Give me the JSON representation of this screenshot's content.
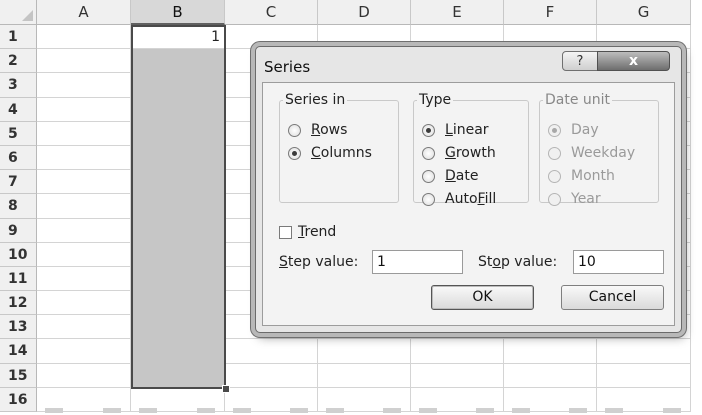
{
  "sheet": {
    "columns": [
      {
        "label": "A",
        "width": 94
      },
      {
        "label": "B",
        "width": 94
      },
      {
        "label": "C",
        "width": 93
      },
      {
        "label": "D",
        "width": 93
      },
      {
        "label": "E",
        "width": 93
      },
      {
        "label": "F",
        "width": 93
      },
      {
        "label": "G",
        "width": 94
      }
    ],
    "rows": [
      "1",
      "2",
      "3",
      "4",
      "5",
      "6",
      "7",
      "8",
      "9",
      "10",
      "11",
      "12",
      "13",
      "14",
      "15",
      "16"
    ],
    "cell_B1": "1"
  },
  "dialog": {
    "title": "Series",
    "help_label": "?",
    "close_label": "x",
    "series_in": {
      "legend": "Series in",
      "options": [
        {
          "pre": "",
          "ul": "R",
          "post": "ows",
          "checked": false
        },
        {
          "pre": "",
          "ul": "C",
          "post": "olumns",
          "checked": true
        }
      ]
    },
    "type": {
      "legend": "Type",
      "options": [
        {
          "pre": "",
          "ul": "L",
          "post": "inear",
          "checked": true
        },
        {
          "pre": "",
          "ul": "G",
          "post": "rowth",
          "checked": false
        },
        {
          "pre": "",
          "ul": "D",
          "post": "ate",
          "checked": false
        },
        {
          "pre": "Auto",
          "ul": "F",
          "post": "ill",
          "checked": false
        }
      ]
    },
    "date_unit": {
      "legend": "Date unit",
      "options": [
        {
          "label": "Day",
          "checked": true
        },
        {
          "label": "Weekday",
          "checked": false
        },
        {
          "label": "Month",
          "checked": false
        },
        {
          "label": "Year",
          "checked": false
        }
      ]
    },
    "trend": {
      "pre": "",
      "ul": "T",
      "post": "rend",
      "checked": false
    },
    "step": {
      "pre": "",
      "ul": "S",
      "post": "tep value:",
      "value": "1"
    },
    "stop": {
      "pre": "St",
      "ul": "o",
      "post": "p value:",
      "value": "10"
    },
    "ok_label": "OK",
    "cancel_label": "Cancel"
  }
}
